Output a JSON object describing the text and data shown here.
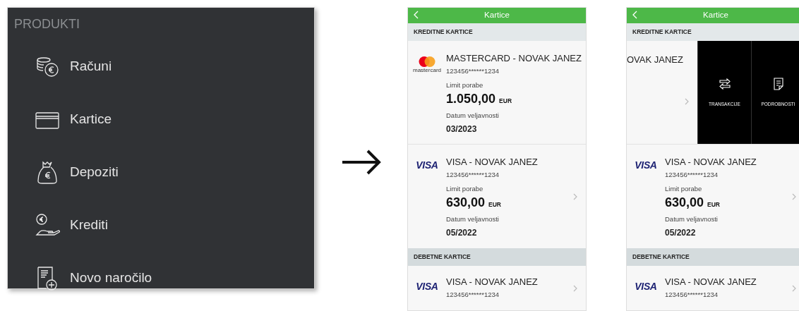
{
  "menu": {
    "heading": "PRODUKTI",
    "items": [
      {
        "label": "Računi",
        "kind": "coins"
      },
      {
        "label": "Kartice",
        "kind": "card"
      },
      {
        "label": "Depoziti",
        "kind": "moneybag"
      },
      {
        "label": "Krediti",
        "kind": "hand"
      },
      {
        "label": "Novo naročilo",
        "kind": "neworder"
      }
    ]
  },
  "screens": [
    {
      "title": "Kartice",
      "sections": [
        {
          "heading": "KREDITNE KARTICE",
          "cards": [
            {
              "kind": "full",
              "logo": {
                "kind": "circles",
                "text": "mastercard"
              },
              "name": "MASTERCARD - NOVAK JANEZ",
              "number": "123456******1234",
              "limit_label": "Limit porabe",
              "limit": "1.050,00",
              "currency": "EUR",
              "expiry_label": "Datum veljavnosti",
              "expiry": "03/2023"
            },
            {
              "kind": "full",
              "logo": {
                "kind": "wordmark",
                "text": "VISA"
              },
              "name": "VISA - NOVAK JANEZ",
              "number": "123456******1234",
              "limit_label": "Limit porabe",
              "limit": "630,00",
              "currency": "EUR",
              "expiry_label": "Datum veljavnosti",
              "expiry": "05/2022"
            }
          ]
        },
        {
          "heading": "DEBETNE KARTICE",
          "cards": [
            {
              "kind": "short",
              "logo": {
                "kind": "wordmark",
                "text": "VISA"
              },
              "name": "VISA - NOVAK JANEZ",
              "number": "123456******1234"
            }
          ]
        }
      ]
    },
    {
      "title": "Kartice",
      "sections": [
        {
          "heading": "KREDITNE KARTICE",
          "cards": [
            {
              "kind": "swiped",
              "name": "OVAK JANEZ",
              "actions": [
                {
                  "label": "TRANSAKCIJE",
                  "kind": "transfer"
                },
                {
                  "label": "PODROBNOSTI",
                  "kind": "document"
                }
              ]
            },
            {
              "kind": "full",
              "logo": {
                "kind": "wordmark",
                "text": "VISA"
              },
              "name": "VISA - NOVAK JANEZ",
              "number": "123456******1234",
              "limit_label": "Limit porabe",
              "limit": "630,00",
              "currency": "EUR",
              "expiry_label": "Datum veljavnosti",
              "expiry": "05/2022"
            }
          ]
        },
        {
          "heading": "DEBETNE KARTICE",
          "cards": [
            {
              "kind": "short",
              "logo": {
                "kind": "wordmark",
                "text": "VISA"
              },
              "name": "VISA - NOVAK JANEZ",
              "number": "123456******1234"
            }
          ]
        }
      ]
    }
  ]
}
